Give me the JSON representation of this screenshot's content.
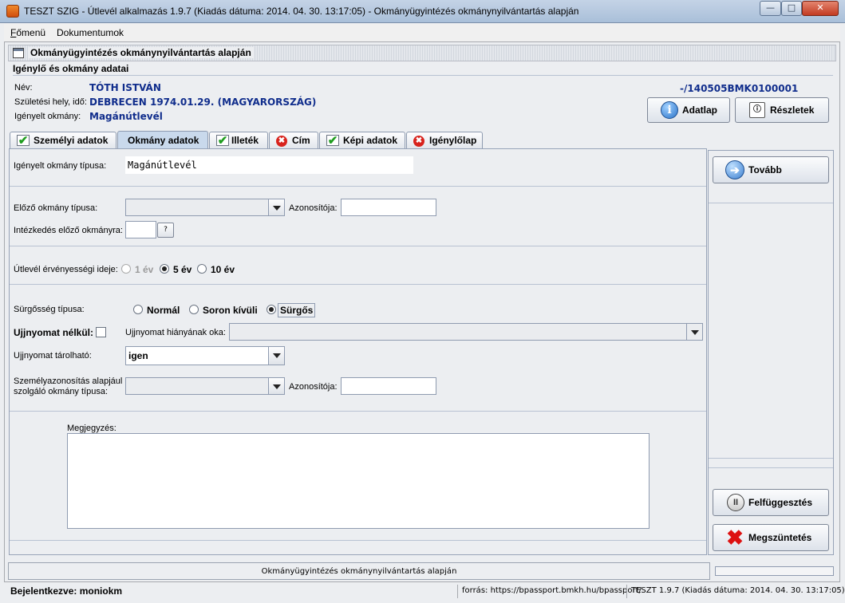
{
  "window": {
    "title": "TESZT SZIG - Útlevél alkalmazás 1.9.7 (Kiadás dátuma: 2014. 04. 30. 13:17:05) - Okmányügyintézés okmánynyilvántartás alapján"
  },
  "menu": {
    "main": "Főmenü",
    "main_rest": "őmenü",
    "main_ul": "F",
    "docs": "Dokumentumok"
  },
  "inner_window": {
    "title": "Okmányügyintézés okmánynyilvántartás alapján"
  },
  "header": {
    "section_title": "Igénylő és okmány adatai",
    "name_label": "Név:",
    "name_value": "TÓTH ISTVÁN",
    "birth_label": "Születési hely, idő:",
    "birth_value": "DEBRECEN 1974.01.29.  (MAGYARORSZÁG)",
    "doc_label": "Igényelt okmány:",
    "doc_value": "Magánútlevél",
    "id_value": "-/140505BMK0100001",
    "adatlap_label": "Adatlap",
    "reszletek_label": "Részletek"
  },
  "tabs": [
    {
      "label": "Személyi adatok",
      "icon": "check"
    },
    {
      "label": "Okmány adatok",
      "icon": "none"
    },
    {
      "label": "Illeték",
      "icon": "check"
    },
    {
      "label": "Cím",
      "icon": "error"
    },
    {
      "label": "Képi adatok",
      "icon": "check"
    },
    {
      "label": "Igénylőlap",
      "icon": "error"
    }
  ],
  "form": {
    "requested_type_label": "Igényelt okmány típusa:",
    "requested_type_value": "Magánútlevél",
    "prev_type_label": "Előző okmány típusa:",
    "prev_type_value": "",
    "prev_id_label": "Azonosítója:",
    "prev_id_value": "",
    "prev_action_label": "Intézkedés előző okmányra:",
    "prev_action_value": "",
    "help_button": "?",
    "validity_label": "Útlevél érvényességi ideje:",
    "validity_options": [
      "1 év",
      "5 év",
      "10 év"
    ],
    "validity_selected": "5 év",
    "urgency_label": "Sürgősség típusa:",
    "urgency_options": [
      "Normál",
      "Soron kívüli",
      "Sürgős"
    ],
    "urgency_selected": "Sürgős",
    "no_fingerprint_label": "Ujjnyomat nélkül:",
    "no_fingerprint_checked": false,
    "missing_reason_label": "Ujjnyomat hiányának oka:",
    "missing_reason_value": "",
    "storable_label": "Ujjnyomat tárolható:",
    "storable_value": "igen",
    "id_doc_label_1": "Személyazonosítás alapjául",
    "id_doc_label_2": "szolgáló okmány típusa:",
    "id_doc_value": "",
    "id_doc_id_label": "Azonosítója:",
    "id_doc_id_value": "",
    "note_label": "Megjegyzés:",
    "note_value": ""
  },
  "side": {
    "next": "Tovább",
    "suspend": "Felfüggesztés",
    "cancel": "Megszüntetés"
  },
  "status": {
    "text": "Okmányügyintézés okmánynyilvántartás alapján"
  },
  "footer": {
    "login": "Bejelentkezve: moniokm",
    "source": "forrás: https://bpassport.bmkh.hu/bpassport/",
    "version": "TESZT 1.9.7 (Kiadás dátuma: 2014. 04. 30. 13:17:05)"
  }
}
